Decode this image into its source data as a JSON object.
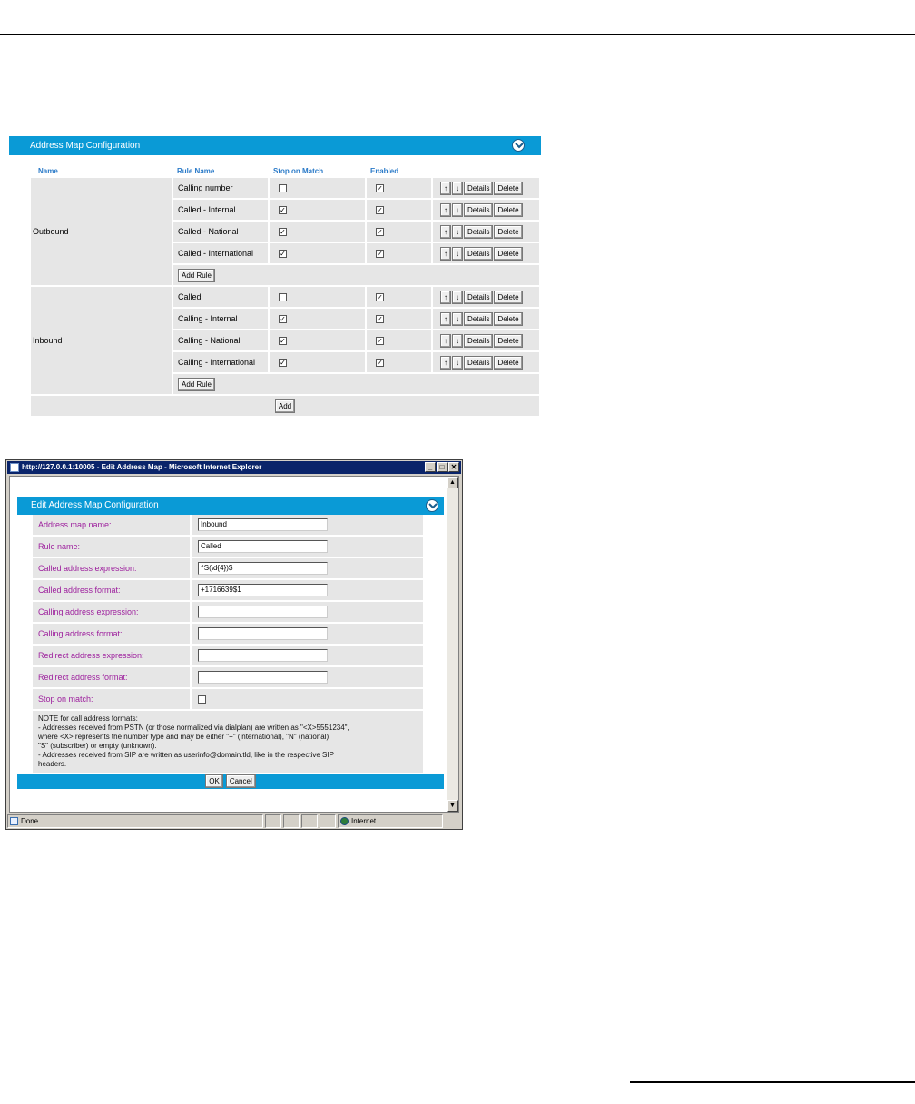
{
  "address_map": {
    "title": "Address Map Configuration",
    "columns": {
      "name": "Name",
      "rule_name": "Rule Name",
      "stop_on_match": "Stop on Match",
      "enabled": "Enabled"
    },
    "actions": {
      "up": "↑",
      "down": "↓",
      "details": "Details",
      "delete": "Delete"
    },
    "add_rule_label": "Add Rule",
    "add_label": "Add",
    "groups": [
      {
        "name": "Outbound",
        "rules": [
          {
            "name": "Calling number",
            "stop": "",
            "enabled": "✓"
          },
          {
            "name": "Called - Internal",
            "stop": "✓",
            "enabled": "✓"
          },
          {
            "name": "Called - National",
            "stop": "✓",
            "enabled": "✓"
          },
          {
            "name": "Called - International",
            "stop": "✓",
            "enabled": "✓"
          }
        ]
      },
      {
        "name": "Inbound",
        "rules": [
          {
            "name": "Called",
            "stop": "",
            "enabled": "✓"
          },
          {
            "name": "Calling - Internal",
            "stop": "✓",
            "enabled": "✓"
          },
          {
            "name": "Calling - National",
            "stop": "✓",
            "enabled": "✓"
          },
          {
            "name": "Calling - International",
            "stop": "✓",
            "enabled": "✓"
          }
        ]
      }
    ]
  },
  "ie_window": {
    "title": "http://127.0.0.1:10005 - Edit Address Map - Microsoft Internet Explorer",
    "controls": {
      "minimize": "_",
      "maximize": "□",
      "close": "✕"
    },
    "edit_panel": {
      "title": "Edit Address Map Configuration",
      "fields": [
        {
          "label": "Address map name:",
          "value": "Inbound"
        },
        {
          "label": "Rule name:",
          "value": "Called"
        },
        {
          "label": "Called address expression:",
          "value": "^S(\\d{4})$"
        },
        {
          "label": "Called address format:",
          "value": "+1716639$1"
        },
        {
          "label": "Calling address expression:",
          "value": ""
        },
        {
          "label": "Calling address format:",
          "value": ""
        },
        {
          "label": "Redirect address expression:",
          "value": ""
        },
        {
          "label": "Redirect address format:",
          "value": ""
        }
      ],
      "stop_on_match_label": "Stop on match:",
      "note": {
        "line1": "NOTE for call address formats:",
        "line2": "- Addresses received from PSTN (or those normalized via dialplan) are written as \"<X>5551234\",",
        "line3": "where <X> represents the number type and may be either \"+\" (international), \"N\" (national),",
        "line4": "\"S\" (subscriber) or empty (unknown).",
        "line5": "- Addresses received from SIP are written as userinfo@domain.tld, like in the respective SIP",
        "line6": "headers."
      },
      "ok_label": "OK",
      "cancel_label": "Cancel"
    },
    "status": {
      "text": "Done",
      "zone": "Internet"
    }
  },
  "colors": {
    "header_blue": "#0a9ad6",
    "label_purple": "#9d1f9d",
    "row_gray": "#e6e6e6"
  }
}
